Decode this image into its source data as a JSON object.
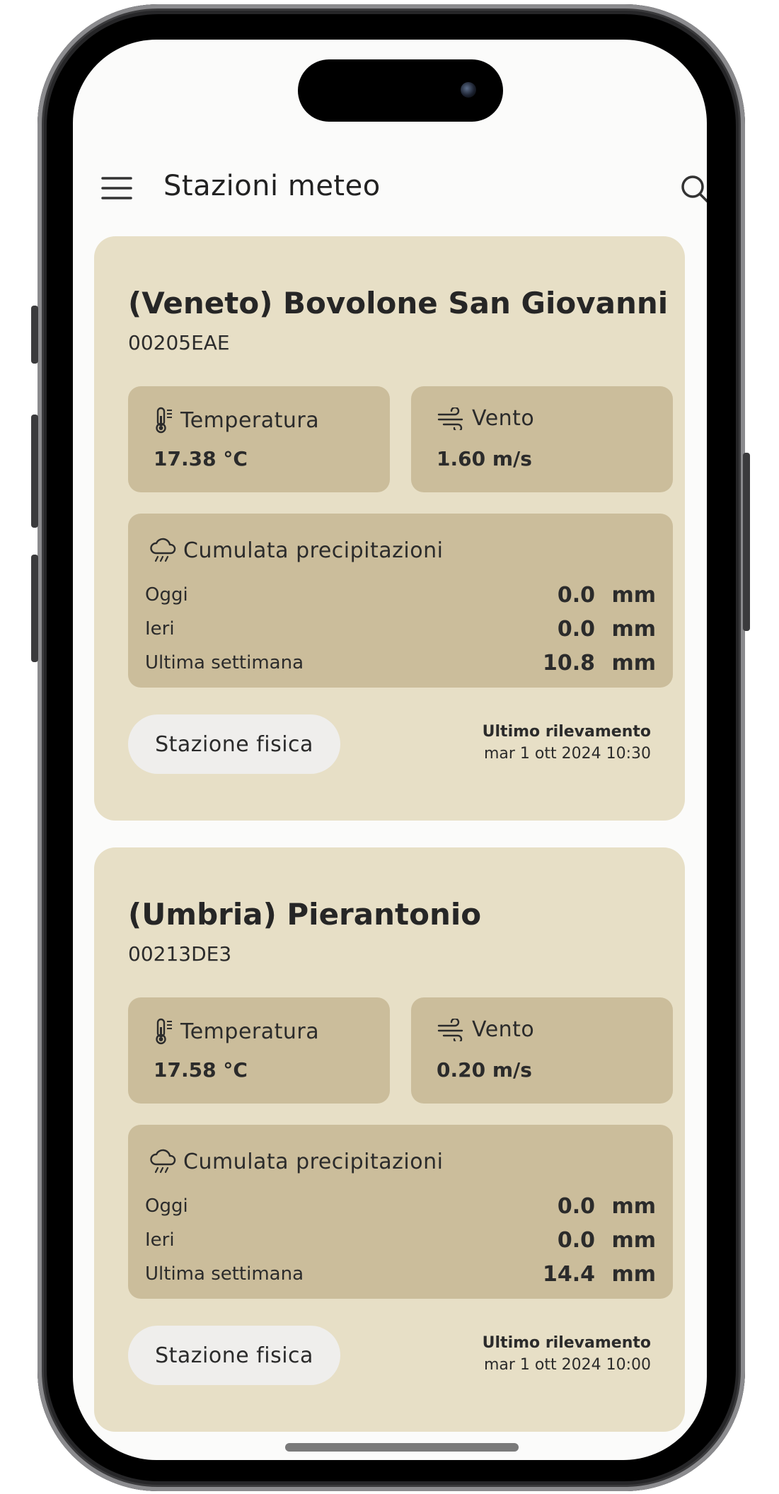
{
  "header": {
    "title": "Stazioni meteo",
    "menu_icon": "hamburger-menu-icon",
    "search_icon": "search-icon"
  },
  "stations": [
    {
      "title": "(Veneto) Bovolone San Giovanni",
      "code": "00205EAE",
      "temperature": {
        "label": "Temperatura",
        "value": "17.38 °C",
        "icon": "thermometer-icon"
      },
      "wind": {
        "label": "Vento",
        "value": "1.60 m/s",
        "icon": "wind-icon"
      },
      "precipitation": {
        "label": "Cumulata precipitazioni",
        "icon": "rain-cloud-icon",
        "rows": [
          {
            "label": "Oggi",
            "value": "0.0",
            "unit": "mm"
          },
          {
            "label": "Ieri",
            "value": "0.0",
            "unit": "mm"
          },
          {
            "label": "Ultima settimana",
            "value": "10.8",
            "unit": "mm"
          }
        ]
      },
      "type_button": "Stazione fisica",
      "last_reading_label": "Ultimo rilevamento",
      "last_reading_time": "mar 1 ott 2024 10:30"
    },
    {
      "title": "(Umbria) Pierantonio",
      "code": "00213DE3",
      "temperature": {
        "label": "Temperatura",
        "value": "17.58 °C",
        "icon": "thermometer-icon"
      },
      "wind": {
        "label": "Vento",
        "value": "0.20 m/s",
        "icon": "wind-icon"
      },
      "precipitation": {
        "label": "Cumulata precipitazioni",
        "icon": "rain-cloud-icon",
        "rows": [
          {
            "label": "Oggi",
            "value": "0.0",
            "unit": "mm"
          },
          {
            "label": "Ieri",
            "value": "0.0",
            "unit": "mm"
          },
          {
            "label": "Ultima settimana",
            "value": "14.4",
            "unit": "mm"
          }
        ]
      },
      "type_button": "Stazione fisica",
      "last_reading_label": "Ultimo rilevamento",
      "last_reading_time": "mar 1 ott 2024 10:00"
    }
  ],
  "colors": {
    "card_bg": "#e7dfc6",
    "tile_bg": "#cbbd9b",
    "chip_bg": "#efeeec",
    "text": "#2b2b2b"
  }
}
